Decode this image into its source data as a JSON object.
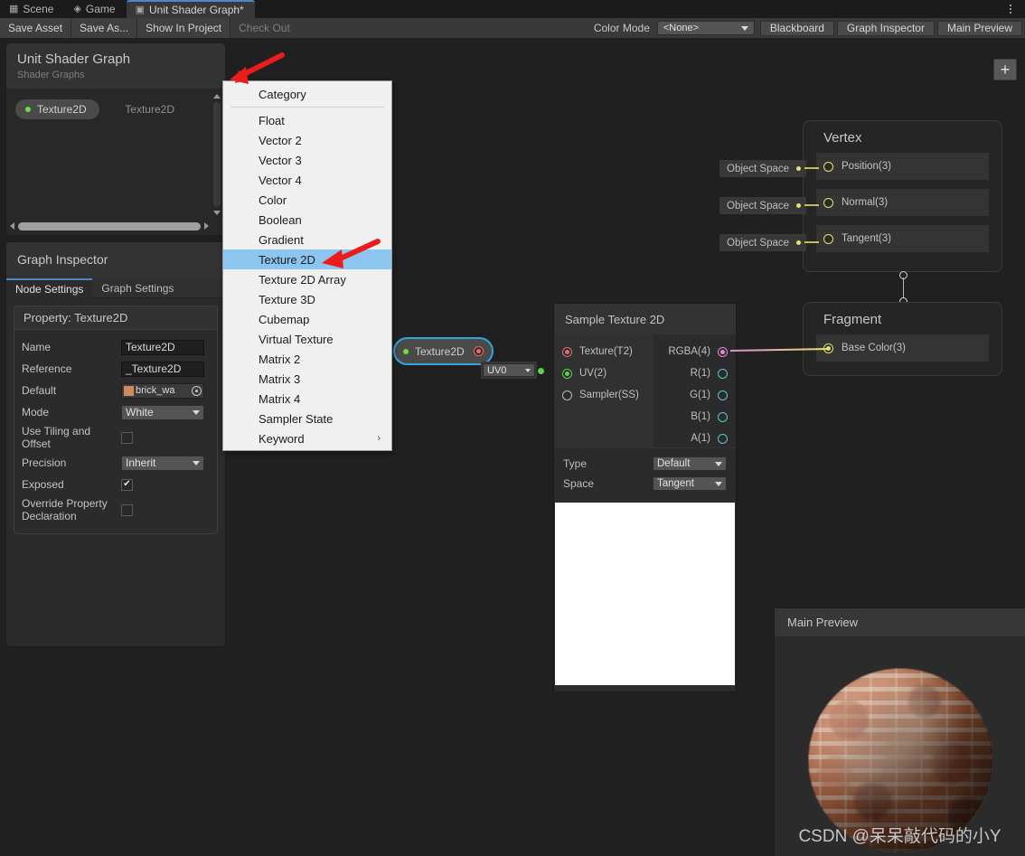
{
  "tabs": [
    {
      "label": "Scene",
      "icon": "grid-icon",
      "active": false
    },
    {
      "label": "Game",
      "icon": "gamepad-icon",
      "active": false
    },
    {
      "label": "Unit Shader Graph*",
      "icon": "shader-graph-icon",
      "active": true
    }
  ],
  "toolbar": {
    "save_asset": "Save Asset",
    "save_as": "Save As...",
    "show_in_project": "Show In Project",
    "check_out": "Check Out",
    "color_mode_label": "Color Mode",
    "color_mode_value": "<None>",
    "blackboard": "Blackboard",
    "graph_inspector": "Graph Inspector",
    "main_preview": "Main Preview"
  },
  "blackboard": {
    "title": "Unit Shader Graph",
    "subtitle": "Shader Graphs",
    "add_label": "+",
    "property_name": "Texture2D",
    "property_type": "Texture2D"
  },
  "inspector": {
    "title": "Graph Inspector",
    "tabs": [
      {
        "label": "Node Settings",
        "active": true
      },
      {
        "label": "Graph Settings",
        "active": false
      }
    ],
    "panel_title": "Property: Texture2D",
    "fields": {
      "name_label": "Name",
      "name_value": "Texture2D",
      "reference_label": "Reference",
      "reference_value": "_Texture2D",
      "default_label": "Default",
      "default_value": "brick_wa",
      "default_swatch": "#d08a5e",
      "mode_label": "Mode",
      "mode_value": "White",
      "tiling_label": "Use Tiling and Offset",
      "tiling_checked": "",
      "precision_label": "Precision",
      "precision_value": "Inherit",
      "exposed_label": "Exposed",
      "exposed_checked": "✔",
      "override_label": "Override Property Declaration",
      "override_checked": ""
    }
  },
  "menu": {
    "header": "Category",
    "items": [
      {
        "label": "Float",
        "selected": false,
        "submenu": false
      },
      {
        "label": "Vector 2",
        "selected": false,
        "submenu": false
      },
      {
        "label": "Vector 3",
        "selected": false,
        "submenu": false
      },
      {
        "label": "Vector 4",
        "selected": false,
        "submenu": false
      },
      {
        "label": "Color",
        "selected": false,
        "submenu": false
      },
      {
        "label": "Boolean",
        "selected": false,
        "submenu": false
      },
      {
        "label": "Gradient",
        "selected": false,
        "submenu": false
      },
      {
        "label": "Texture 2D",
        "selected": true,
        "submenu": false
      },
      {
        "label": "Texture 2D Array",
        "selected": false,
        "submenu": false
      },
      {
        "label": "Texture 3D",
        "selected": false,
        "submenu": false
      },
      {
        "label": "Cubemap",
        "selected": false,
        "submenu": false
      },
      {
        "label": "Virtual Texture",
        "selected": false,
        "submenu": false
      },
      {
        "label": "Matrix 2",
        "selected": false,
        "submenu": false
      },
      {
        "label": "Matrix 3",
        "selected": false,
        "submenu": false
      },
      {
        "label": "Matrix 4",
        "selected": false,
        "submenu": false
      },
      {
        "label": "Sampler State",
        "selected": false,
        "submenu": false
      },
      {
        "label": "Keyword",
        "selected": false,
        "submenu": true
      }
    ],
    "submenu_arrow": "›"
  },
  "graph": {
    "property_node": {
      "label": "Texture2D"
    },
    "uv_node": {
      "value": "UV0"
    },
    "sample_node": {
      "title": "Sample Texture 2D",
      "inputs": [
        {
          "label": "Texture(T2)",
          "connected": true,
          "color": "#e07070"
        },
        {
          "label": "UV(2)",
          "connected": true,
          "color": "#5ad24a"
        },
        {
          "label": "Sampler(SS)",
          "connected": false,
          "color": "#bcbcbc"
        }
      ],
      "outputs": [
        {
          "label": "RGBA(4)",
          "connected": true,
          "color": "#e08ad0"
        },
        {
          "label": "R(1)",
          "connected": false,
          "color": "#4fc9d6"
        },
        {
          "label": "G(1)",
          "connected": false,
          "color": "#4fc9d6"
        },
        {
          "label": "B(1)",
          "connected": false,
          "color": "#4fc9d6"
        },
        {
          "label": "A(1)",
          "connected": false,
          "color": "#4fc9d6"
        }
      ],
      "settings": [
        {
          "label": "Type",
          "value": "Default"
        },
        {
          "label": "Space",
          "value": "Tangent"
        }
      ]
    },
    "vertex_node": {
      "title": "Vertex",
      "rows": [
        {
          "label": "Position(3)",
          "space": "Object Space"
        },
        {
          "label": "Normal(3)",
          "space": "Object Space"
        },
        {
          "label": "Tangent(3)",
          "space": "Object Space"
        }
      ]
    },
    "fragment_node": {
      "title": "Fragment",
      "rows": [
        {
          "label": "Base Color(3)"
        }
      ]
    }
  },
  "main_preview": {
    "title": "Main Preview",
    "watermark": "CSDN @呆呆敲代码的小Y"
  },
  "colors": {
    "accent_blue": "#4a88c7",
    "selection_blue": "#8cc6f0",
    "node_selected_outline": "#2fa5e0",
    "arrow_red": "#ea1c1c",
    "port_texture": "#e07070",
    "port_uv": "#5ad24a",
    "port_rgba": "#e08ad0",
    "port_channel": "#4fc9d6",
    "port_vertex": "#e8e46a",
    "property_dot_green": "#6fdc3a"
  }
}
